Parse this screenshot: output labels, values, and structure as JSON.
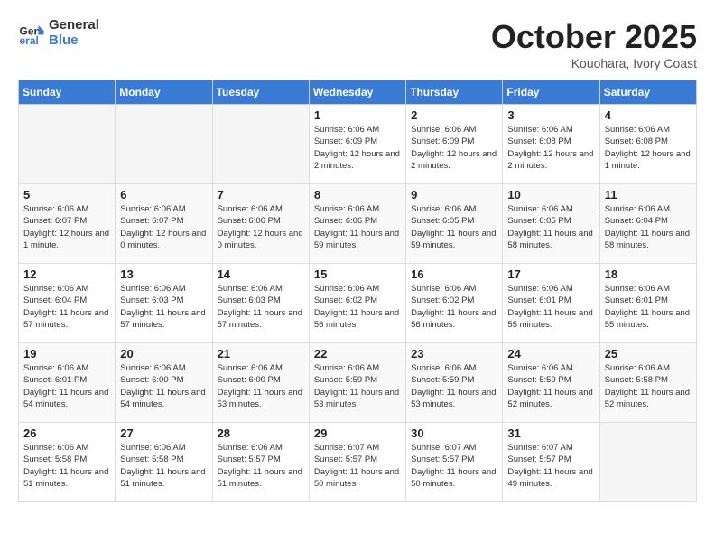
{
  "header": {
    "logo_line1": "General",
    "logo_line2": "Blue",
    "month": "October 2025",
    "location": "Kouohara, Ivory Coast"
  },
  "weekdays": [
    "Sunday",
    "Monday",
    "Tuesday",
    "Wednesday",
    "Thursday",
    "Friday",
    "Saturday"
  ],
  "weeks": [
    [
      {
        "day": "",
        "info": ""
      },
      {
        "day": "",
        "info": ""
      },
      {
        "day": "",
        "info": ""
      },
      {
        "day": "1",
        "info": "Sunrise: 6:06 AM\nSunset: 6:09 PM\nDaylight: 12 hours and 2 minutes."
      },
      {
        "day": "2",
        "info": "Sunrise: 6:06 AM\nSunset: 6:09 PM\nDaylight: 12 hours and 2 minutes."
      },
      {
        "day": "3",
        "info": "Sunrise: 6:06 AM\nSunset: 6:08 PM\nDaylight: 12 hours and 2 minutes."
      },
      {
        "day": "4",
        "info": "Sunrise: 6:06 AM\nSunset: 6:08 PM\nDaylight: 12 hours and 1 minute."
      }
    ],
    [
      {
        "day": "5",
        "info": "Sunrise: 6:06 AM\nSunset: 6:07 PM\nDaylight: 12 hours and 1 minute."
      },
      {
        "day": "6",
        "info": "Sunrise: 6:06 AM\nSunset: 6:07 PM\nDaylight: 12 hours and 0 minutes."
      },
      {
        "day": "7",
        "info": "Sunrise: 6:06 AM\nSunset: 6:06 PM\nDaylight: 12 hours and 0 minutes."
      },
      {
        "day": "8",
        "info": "Sunrise: 6:06 AM\nSunset: 6:06 PM\nDaylight: 11 hours and 59 minutes."
      },
      {
        "day": "9",
        "info": "Sunrise: 6:06 AM\nSunset: 6:05 PM\nDaylight: 11 hours and 59 minutes."
      },
      {
        "day": "10",
        "info": "Sunrise: 6:06 AM\nSunset: 6:05 PM\nDaylight: 11 hours and 58 minutes."
      },
      {
        "day": "11",
        "info": "Sunrise: 6:06 AM\nSunset: 6:04 PM\nDaylight: 11 hours and 58 minutes."
      }
    ],
    [
      {
        "day": "12",
        "info": "Sunrise: 6:06 AM\nSunset: 6:04 PM\nDaylight: 11 hours and 57 minutes."
      },
      {
        "day": "13",
        "info": "Sunrise: 6:06 AM\nSunset: 6:03 PM\nDaylight: 11 hours and 57 minutes."
      },
      {
        "day": "14",
        "info": "Sunrise: 6:06 AM\nSunset: 6:03 PM\nDaylight: 11 hours and 57 minutes."
      },
      {
        "day": "15",
        "info": "Sunrise: 6:06 AM\nSunset: 6:02 PM\nDaylight: 11 hours and 56 minutes."
      },
      {
        "day": "16",
        "info": "Sunrise: 6:06 AM\nSunset: 6:02 PM\nDaylight: 11 hours and 56 minutes."
      },
      {
        "day": "17",
        "info": "Sunrise: 6:06 AM\nSunset: 6:01 PM\nDaylight: 11 hours and 55 minutes."
      },
      {
        "day": "18",
        "info": "Sunrise: 6:06 AM\nSunset: 6:01 PM\nDaylight: 11 hours and 55 minutes."
      }
    ],
    [
      {
        "day": "19",
        "info": "Sunrise: 6:06 AM\nSunset: 6:01 PM\nDaylight: 11 hours and 54 minutes."
      },
      {
        "day": "20",
        "info": "Sunrise: 6:06 AM\nSunset: 6:00 PM\nDaylight: 11 hours and 54 minutes."
      },
      {
        "day": "21",
        "info": "Sunrise: 6:06 AM\nSunset: 6:00 PM\nDaylight: 11 hours and 53 minutes."
      },
      {
        "day": "22",
        "info": "Sunrise: 6:06 AM\nSunset: 5:59 PM\nDaylight: 11 hours and 53 minutes."
      },
      {
        "day": "23",
        "info": "Sunrise: 6:06 AM\nSunset: 5:59 PM\nDaylight: 11 hours and 53 minutes."
      },
      {
        "day": "24",
        "info": "Sunrise: 6:06 AM\nSunset: 5:59 PM\nDaylight: 11 hours and 52 minutes."
      },
      {
        "day": "25",
        "info": "Sunrise: 6:06 AM\nSunset: 5:58 PM\nDaylight: 11 hours and 52 minutes."
      }
    ],
    [
      {
        "day": "26",
        "info": "Sunrise: 6:06 AM\nSunset: 5:58 PM\nDaylight: 11 hours and 51 minutes."
      },
      {
        "day": "27",
        "info": "Sunrise: 6:06 AM\nSunset: 5:58 PM\nDaylight: 11 hours and 51 minutes."
      },
      {
        "day": "28",
        "info": "Sunrise: 6:06 AM\nSunset: 5:57 PM\nDaylight: 11 hours and 51 minutes."
      },
      {
        "day": "29",
        "info": "Sunrise: 6:07 AM\nSunset: 5:57 PM\nDaylight: 11 hours and 50 minutes."
      },
      {
        "day": "30",
        "info": "Sunrise: 6:07 AM\nSunset: 5:57 PM\nDaylight: 11 hours and 50 minutes."
      },
      {
        "day": "31",
        "info": "Sunrise: 6:07 AM\nSunset: 5:57 PM\nDaylight: 11 hours and 49 minutes."
      },
      {
        "day": "",
        "info": ""
      }
    ]
  ]
}
